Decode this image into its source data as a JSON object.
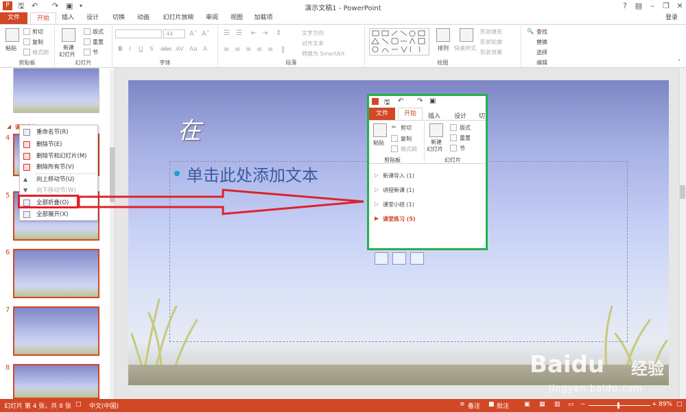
{
  "window": {
    "title": "演示文稿1 - PowerPoint",
    "help": "?",
    "login": "登录"
  },
  "tabs": [
    "文件",
    "开始",
    "插入",
    "设计",
    "切换",
    "动画",
    "幻灯片放映",
    "审阅",
    "视图",
    "加载项"
  ],
  "ribbon": {
    "clipboard": {
      "paste": "粘贴",
      "cut": "剪切",
      "copy": "复制",
      "format_painter": "格式刷",
      "label": "剪贴板"
    },
    "slides": {
      "new_slide_l1": "新建",
      "new_slide_l2": "幻灯片",
      "layout": "版式",
      "reset": "重置",
      "section": "节",
      "label": "幻灯片"
    },
    "font": {
      "size": "44",
      "label": "字体"
    },
    "paragraph": {
      "text_direction": "文字方向",
      "align_text": "对齐文本",
      "smartart": "转换为 SmartArt",
      "label": "段落"
    },
    "drawing": {
      "arrange": "排列",
      "quick_styles": "快速样式",
      "shape_fill": "形状填充",
      "shape_outline": "形状轮廓",
      "shape_effects": "形状效果",
      "label": "绘图"
    },
    "editing": {
      "find": "查找",
      "replace": "替换",
      "select": "选择",
      "label": "编辑"
    }
  },
  "left_pane": {
    "section_header": "课堂练习",
    "slide_numbers": [
      "4",
      "5",
      "6",
      "7",
      "8"
    ]
  },
  "context_menu": [
    {
      "label": "重命名节(R)",
      "enabled": true
    },
    {
      "label": "删除节(E)",
      "enabled": true
    },
    {
      "label": "删除节和幻灯片(M)",
      "enabled": true
    },
    {
      "label": "删除所有节(V)",
      "enabled": true
    },
    {
      "label": "向上移动节(U)",
      "enabled": true
    },
    {
      "label": "向下移动节(W)",
      "enabled": false
    },
    {
      "label": "全部折叠(O)",
      "enabled": true
    },
    {
      "label": "全部展开(X)",
      "enabled": true
    }
  ],
  "slide": {
    "title": "在",
    "body": "单击此处添加文本"
  },
  "inset": {
    "tabs": [
      "文件",
      "开始",
      "插入",
      "设计",
      "切"
    ],
    "paste": "粘贴",
    "cut": "剪切",
    "copy": "复制",
    "format_painter": "格式刷",
    "new_slide_l1": "新建",
    "new_slide_l2": "幻灯片",
    "layout": "版式",
    "reset": "重置",
    "section": "节",
    "clipboard_label": "剪贴板",
    "slides_label": "幻灯片",
    "sections": [
      {
        "label": "新课导入 (1)",
        "active": false
      },
      {
        "label": "讲授新课 (1)",
        "active": false
      },
      {
        "label": "课堂小结 (1)",
        "active": false
      },
      {
        "label": "课堂练习 (5)",
        "active": true
      }
    ]
  },
  "status": {
    "slide_info": "幻灯片 第 4 张，共 8 张",
    "language": "中文(中国)",
    "notes": "备注",
    "comments": "批注",
    "zoom": "89%"
  },
  "watermark": {
    "brand": "Baidu",
    "brand_cn": "经验",
    "url": "jingyan.baidu.com"
  },
  "colors": {
    "accent": "#d24726",
    "highlight_red": "#e0202a",
    "inset_border": "#22b24c"
  }
}
